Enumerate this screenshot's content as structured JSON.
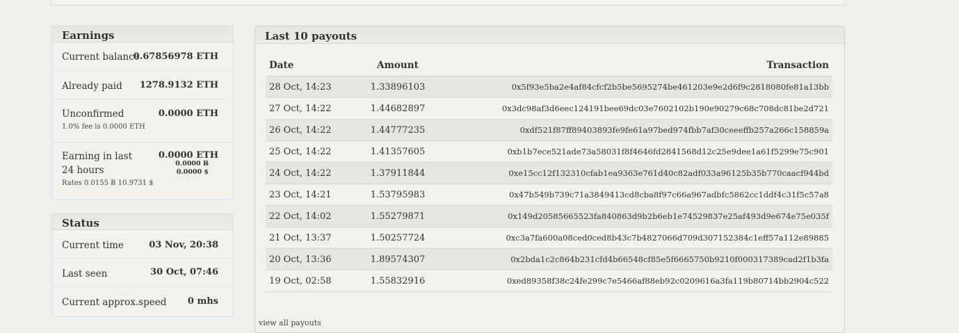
{
  "earnings": {
    "title": "Earnings",
    "current_balance": {
      "label": "Current balance",
      "value": "0.67856978 ETH"
    },
    "already_paid": {
      "label": "Already paid",
      "value": "1278.9132 ETH"
    },
    "unconfirmed": {
      "label": "Unconfirmed",
      "value": "0.0000 ETH",
      "note": "1.0% fee is 0.0000 ETH"
    },
    "last24": {
      "label": "Earning in last 24 hours",
      "value": "0.0000 ETH",
      "btc": "0.0000 Ƀ",
      "usd": "0.0000 $",
      "rates": "Rates 0.0155 Ƀ 10.9731 $"
    }
  },
  "status": {
    "title": "Status",
    "current_time": {
      "label": "Current time",
      "value": "03 Nov, 20:38"
    },
    "last_seen": {
      "label": "Last seen",
      "value": "30 Oct, 07:46"
    },
    "speed": {
      "label": "Current approx.speed",
      "value": "0 mhs"
    }
  },
  "payouts": {
    "title": "Last 10 payouts",
    "columns": [
      "Date",
      "Amount",
      "Transaction"
    ],
    "rows": [
      [
        "28 Oct, 14:23",
        "1.33896103",
        "0x5f93e5ba2e4af84cfcf2b5be5695274be461203e9e2d6f9c2818080fe81a13bb"
      ],
      [
        "27 Oct, 14:22",
        "1.44682897",
        "0x3dc98af3d6eec124191bee69dc03e7602102b190e90279c68c708dc81be2d721"
      ],
      [
        "26 Oct, 14:22",
        "1.44777235",
        "0xdf521f87ff89403893fe9fe61a97bed974fbb7af30ceeeffb257a266c158859a"
      ],
      [
        "25 Oct, 14:22",
        "1.41357605",
        "0xb1b7ece521ade73a58031f8f4646fd2841568d12c25e9dee1a61f5299e75c901"
      ],
      [
        "24 Oct, 14:22",
        "1.37911844",
        "0xe15cc12f132310cfab1ea9363e761d40c82adf033a96125b35b770caacf944bd"
      ],
      [
        "23 Oct, 14:21",
        "1.53795983",
        "0x47b549b739c71a3849413cd8cba8f97c66a967adbfc5862cc1ddf4c31f5c57a8"
      ],
      [
        "22 Oct, 14:02",
        "1.55279871",
        "0x149d20585665523fa840863d9b2b6eb1e74529837e25af493d9e674e75e035f"
      ],
      [
        "21 Oct, 13:37",
        "1.50257724",
        "0xc3a7fa600a08ced0ced8b43c7b4827066d709d307152384c1eff57a112e89885"
      ],
      [
        "20 Oct, 13:36",
        "1.89574307",
        "0x2bda1c2c864b231cfd4b66548cf85e5f6665750b9210f000317389cad2f1b3fa"
      ],
      [
        "19 Oct, 02:58",
        "1.55832916",
        "0xed89358f38c24fe299c7e5466af88eb92c0209616a3fa119b80714bb2904c522"
      ]
    ],
    "more_link": "view all payouts"
  }
}
